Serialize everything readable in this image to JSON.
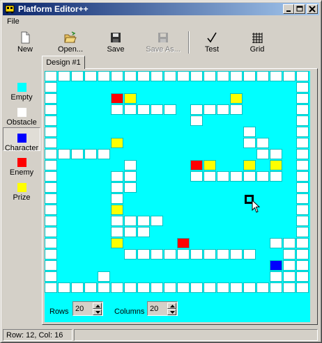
{
  "window": {
    "title": "Platform Editor++"
  },
  "menu": {
    "file": "File"
  },
  "toolbar": {
    "new": "New",
    "open": "Open...",
    "save": "Save",
    "save_as": "Save As...",
    "test": "Test",
    "grid": "Grid"
  },
  "palette": {
    "items": [
      {
        "label": "Empty",
        "color": "#00ffff"
      },
      {
        "label": "Obstacle",
        "color": "#ffffff"
      },
      {
        "label": "Character",
        "color": "#0000ff"
      },
      {
        "label": "Enemy",
        "color": "#ff0000"
      },
      {
        "label": "Prize",
        "color": "#ffff00"
      }
    ],
    "selected": "Character"
  },
  "tabs": [
    {
      "label": "Design #1"
    }
  ],
  "fields": {
    "rows_label": "Rows",
    "rows_value": "20",
    "columns_label": "Columns",
    "columns_value": "20"
  },
  "status": {
    "position": "Row: 12, Col: 16"
  },
  "level": {
    "rows": [
      "11111111111111111111",
      "10000000000000000001",
      "10000340000000400001",
      "10000111110111100001",
      "10000000000100000001",
      "10000000000000010001",
      "10000400000000011001",
      "11111000000000001101",
      "10000010000340040401",
      "10000110000111111101",
      "10000110000000000001",
      "10000100000000000001",
      "10000400000000000001",
      "10000111100000000001",
      "10000111000000000001",
      "10000400003000000111",
      "10000011111111110011",
      "10000000000000000211",
      "10001000000000000111",
      "11111111111111111111"
    ]
  }
}
